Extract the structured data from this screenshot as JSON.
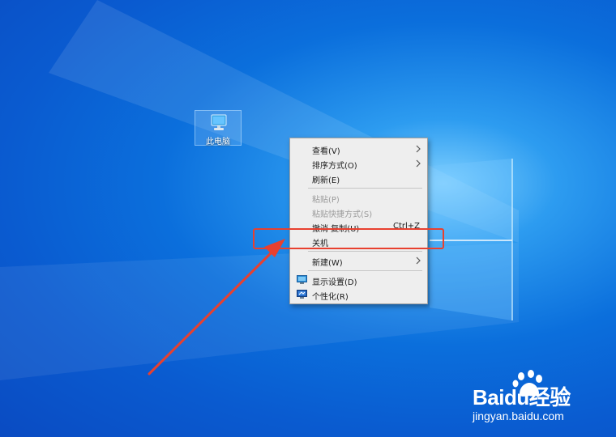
{
  "desktop": {
    "icon_label": "此电脑"
  },
  "context_menu": {
    "items": [
      {
        "label": "查看(V)",
        "submenu": true
      },
      {
        "label": "排序方式(O)",
        "submenu": true
      },
      {
        "label": "刷新(E)"
      },
      {
        "label": "粘贴(P)",
        "disabled": true
      },
      {
        "label": "粘贴快捷方式(S)",
        "disabled": true
      },
      {
        "label": "撤消 复制(U)",
        "shortcut": "Ctrl+Z"
      },
      {
        "label": "关机"
      },
      {
        "label": "新建(W)",
        "submenu": true
      },
      {
        "label": "显示设置(D)",
        "icon": "display-icon"
      },
      {
        "label": "个性化(R)",
        "icon": "personalize-icon"
      }
    ]
  },
  "annotation": {
    "color": "#e8402f"
  },
  "watermark": {
    "brand": "Baidu经验",
    "url": "jingyan.baidu.com"
  }
}
